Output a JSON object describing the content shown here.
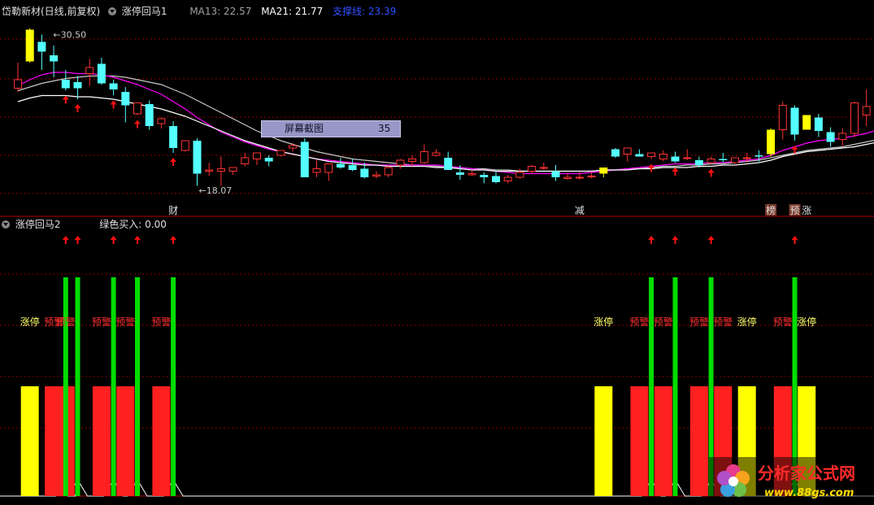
{
  "top_panel": {
    "title": "岱勒新材(日线,前复权)",
    "indicator": "涨停回马1",
    "ma13_label": "MA13: 22.57",
    "ma21_label": "MA21: 21.77",
    "support_label": "支撑线: 23.39",
    "high_label": "30.50",
    "low_label": "18.07",
    "markers": [
      {
        "text": "财",
        "bar": 13
      },
      {
        "text": "减",
        "bar": 47
      },
      {
        "text": "榜",
        "bar": 63
      },
      {
        "text": "预",
        "bar": 65
      },
      {
        "text": "涨",
        "bar": 66
      }
    ]
  },
  "bottom_panel": {
    "indicator": "涨停回马2",
    "green_buy_label": "绿色买入: 0.00"
  },
  "popup": {
    "label": "屏幕截图",
    "value": "35"
  },
  "watermark": {
    "brand": "分析家公式网",
    "url": "www.88gs.com"
  },
  "colors": {
    "bull": "#ff3232",
    "bear": "#54ffff",
    "limit_up": "#ffff00",
    "ma_white": "#ffffff",
    "ma_magenta": "#ff00ff",
    "ma_gray": "#c8c8c8",
    "signal_green": "#00dd00",
    "signal_red": "#ff2020",
    "signal_yellow": "#ffff00",
    "label_yellow": "#ffff66",
    "label_red": "#ff3030",
    "grid": "#8b0000"
  },
  "chart_data": {
    "type": "candlestick",
    "y_high_marked": 30.5,
    "y_low_marked": 18.07,
    "candles": [
      [
        26.1,
        28.2,
        26.8,
        25.8
      ],
      [
        28.3,
        31.0,
        30.9,
        28.2
      ],
      [
        29.9,
        30.5,
        29.1,
        27.6
      ],
      [
        28.8,
        29.6,
        28.3,
        27.0
      ],
      [
        26.8,
        27.6,
        26.1,
        25.9
      ],
      [
        26.6,
        27.1,
        26.1,
        25.2
      ],
      [
        27.3,
        28.5,
        27.8,
        26.3
      ],
      [
        28.1,
        28.6,
        26.5,
        26.4
      ],
      [
        26.5,
        26.8,
        26.0,
        25.5
      ],
      [
        25.8,
        26.2,
        24.7,
        23.3
      ],
      [
        24.0,
        24.5,
        24.9,
        23.9
      ],
      [
        24.8,
        25.1,
        23.0,
        22.7
      ],
      [
        23.2,
        23.7,
        23.6,
        22.8
      ],
      [
        23.0,
        23.4,
        21.2,
        20.8
      ],
      [
        21.0,
        21.6,
        21.8,
        20.9
      ],
      [
        21.8,
        22.0,
        19.1,
        18.1
      ],
      [
        19.3,
        20.0,
        19.4,
        18.9
      ],
      [
        19.3,
        20.5,
        19.5,
        18.1
      ],
      [
        19.3,
        19.6,
        19.6,
        19.0
      ],
      [
        19.9,
        20.8,
        20.4,
        19.7
      ],
      [
        20.3,
        20.7,
        20.8,
        19.8
      ],
      [
        20.4,
        20.6,
        20.1,
        19.7
      ],
      [
        20.6,
        21.0,
        21.0,
        20.5
      ],
      [
        21.2,
        21.6,
        21.4,
        20.9
      ],
      [
        21.7,
        22.0,
        18.8,
        18.8
      ],
      [
        19.2,
        20.2,
        19.5,
        18.8
      ],
      [
        19.2,
        19.5,
        19.9,
        18.5
      ],
      [
        19.9,
        20.4,
        19.6,
        19.5
      ],
      [
        19.8,
        20.3,
        19.4,
        19.3
      ],
      [
        19.5,
        20.0,
        18.8,
        18.7
      ],
      [
        18.9,
        19.3,
        19.0,
        18.7
      ],
      [
        19.0,
        19.8,
        19.6,
        18.8
      ],
      [
        19.8,
        20.3,
        20.2,
        19.5
      ],
      [
        20.1,
        20.6,
        20.3,
        19.7
      ],
      [
        20.0,
        21.5,
        20.9,
        19.9
      ],
      [
        20.6,
        21.1,
        20.8,
        20.5
      ],
      [
        20.4,
        20.9,
        19.4,
        19.4
      ],
      [
        19.2,
        19.8,
        19.0,
        18.6
      ],
      [
        19.0,
        19.4,
        19.1,
        18.9
      ],
      [
        19.0,
        19.2,
        18.8,
        18.3
      ],
      [
        18.9,
        19.3,
        18.4,
        18.3
      ],
      [
        18.5,
        19.0,
        18.8,
        18.3
      ],
      [
        18.8,
        19.5,
        19.2,
        18.7
      ],
      [
        19.3,
        19.8,
        19.7,
        19.1
      ],
      [
        19.6,
        20.0,
        19.6,
        19.4
      ],
      [
        19.3,
        19.8,
        18.8,
        18.5
      ],
      [
        18.7,
        19.1,
        18.8,
        18.6
      ],
      [
        18.8,
        19.2,
        18.8,
        18.6
      ],
      [
        18.9,
        19.2,
        18.9,
        18.7
      ],
      [
        19.1,
        19.4,
        19.6,
        18.8
      ],
      [
        21.1,
        21.2,
        20.5,
        20.4
      ],
      [
        20.7,
        21.1,
        21.2,
        20.1
      ],
      [
        20.7,
        21.1,
        20.5,
        20.5
      ],
      [
        20.5,
        20.8,
        20.8,
        20.3
      ],
      [
        20.3,
        21.0,
        20.7,
        20.1
      ],
      [
        20.5,
        20.9,
        20.1,
        20.0
      ],
      [
        20.4,
        21.1,
        20.4,
        20.2
      ],
      [
        20.2,
        20.5,
        19.8,
        19.6
      ],
      [
        20.0,
        20.5,
        20.3,
        19.9
      ],
      [
        20.3,
        20.8,
        20.2,
        20.0
      ],
      [
        20.0,
        20.4,
        20.4,
        19.9
      ],
      [
        20.4,
        20.8,
        20.4,
        20.0
      ],
      [
        20.6,
        21.0,
        20.5,
        20.1
      ],
      [
        20.7,
        22.8,
        22.7,
        20.5
      ],
      [
        22.7,
        25.0,
        24.7,
        21.9
      ],
      [
        24.5,
        24.7,
        22.3,
        21.8
      ],
      [
        22.7,
        23.2,
        23.9,
        22.7
      ],
      [
        23.7,
        24.0,
        22.6,
        22.1
      ],
      [
        22.5,
        22.9,
        21.7,
        21.3
      ],
      [
        21.9,
        22.8,
        22.4,
        21.4
      ],
      [
        22.4,
        25.0,
        24.9,
        22.1
      ],
      [
        23.9,
        26.0,
        24.6,
        23.0
      ],
      [
        24.9,
        26.3,
        26.0,
        24.4
      ],
      [
        25.3,
        26.1,
        26.2,
        24.5
      ],
      [
        26.2,
        28.2,
        27.5,
        25.7
      ]
    ],
    "ma13": [
      26.3,
      26.8,
      27.2,
      27.4,
      27.4,
      27.3,
      27.3,
      27.2,
      27.0,
      26.7,
      26.4,
      26.0,
      25.6,
      25.0,
      24.4,
      23.7,
      23.1,
      22.5,
      22.1,
      21.7,
      21.4,
      21.1,
      20.9,
      20.7,
      20.5,
      20.3,
      20.2,
      20.1,
      20.0,
      19.9,
      19.8,
      19.8,
      19.8,
      19.8,
      19.8,
      19.8,
      19.7,
      19.6,
      19.5,
      19.4,
      19.3,
      19.2,
      19.1,
      19.1,
      19.1,
      19.1,
      19.1,
      19.1,
      19.2,
      19.3,
      19.4,
      19.5,
      19.6,
      19.7,
      19.8,
      19.9,
      19.9,
      19.9,
      20.0,
      20.0,
      20.1,
      20.2,
      20.3,
      20.6,
      21.0,
      21.3,
      21.6,
      21.8,
      21.9,
      22.0,
      22.2,
      22.4,
      22.7,
      23.1,
      23.5
    ],
    "ma21": [
      25.9,
      26.2,
      26.5,
      26.7,
      26.9,
      27.0,
      27.1,
      27.1,
      27.1,
      27.0,
      26.8,
      26.6,
      26.4,
      26.0,
      25.6,
      25.1,
      24.6,
      24.1,
      23.6,
      23.1,
      22.6,
      22.2,
      21.8,
      21.5,
      21.2,
      20.9,
      20.7,
      20.5,
      20.3,
      20.2,
      20.1,
      20.0,
      19.9,
      19.8,
      19.8,
      19.7,
      19.6,
      19.6,
      19.5,
      19.5,
      19.4,
      19.4,
      19.3,
      19.3,
      19.3,
      19.3,
      19.3,
      19.3,
      19.3,
      19.4,
      19.4,
      19.5,
      19.5,
      19.6,
      19.7,
      19.7,
      19.8,
      19.8,
      19.9,
      19.9,
      20.0,
      20.1,
      20.2,
      20.4,
      20.6,
      20.8,
      21.0,
      21.1,
      21.2,
      21.3,
      21.5,
      21.7,
      21.9,
      22.2,
      22.5
    ],
    "support_line": [
      25.0,
      25.3,
      25.5,
      25.5,
      25.5,
      25.4,
      25.4,
      25.3,
      25.2,
      25.0,
      24.8,
      24.6,
      24.4,
      24.1,
      23.8,
      23.4,
      23.0,
      22.6,
      22.2,
      21.8,
      21.5,
      21.2,
      20.9,
      20.7,
      20.5,
      20.3,
      20.1,
      20.0,
      19.9,
      19.8,
      19.8,
      19.7,
      19.7,
      19.7,
      19.7,
      19.6,
      19.6,
      19.5,
      19.4,
      19.4,
      19.3,
      19.3,
      19.3,
      19.3,
      19.3,
      19.3,
      19.3,
      19.3,
      19.3,
      19.4,
      19.4,
      19.4,
      19.5,
      19.5,
      19.6,
      19.6,
      19.6,
      19.7,
      19.7,
      19.8,
      19.8,
      19.9,
      20.0,
      20.2,
      20.5,
      20.7,
      20.9,
      21.0,
      21.1,
      21.2,
      21.3,
      21.5,
      21.7,
      22.0,
      22.4
    ],
    "up_arrow_bars": [
      4,
      5,
      8,
      10,
      13,
      53,
      55,
      58,
      65
    ],
    "bottom_signals": [
      {
        "bar": 1,
        "bar_color": "yellow",
        "label": "涨停",
        "label_color": "yellow",
        "green_line": false
      },
      {
        "bar": 3,
        "bar_color": "red",
        "label": "预警",
        "label_color": "red",
        "green_line": false
      },
      {
        "bar": 4,
        "bar_color": "red",
        "label": "预警",
        "label_color": "red",
        "green_line": true
      },
      {
        "bar": 5,
        "bar_color": "none",
        "label": "",
        "label_color": "red",
        "green_line": true
      },
      {
        "bar": 7,
        "bar_color": "red",
        "label": "预警",
        "label_color": "red",
        "green_line": false
      },
      {
        "bar": 8,
        "bar_color": "none",
        "label": "",
        "label_color": "red",
        "green_line": true
      },
      {
        "bar": 9,
        "bar_color": "red",
        "label": "预警",
        "label_color": "red",
        "green_line": false
      },
      {
        "bar": 10,
        "bar_color": "none",
        "label": "",
        "label_color": "red",
        "green_line": true
      },
      {
        "bar": 12,
        "bar_color": "red",
        "label": "预警",
        "label_color": "red",
        "green_line": false
      },
      {
        "bar": 13,
        "bar_color": "none",
        "label": "",
        "label_color": "red",
        "green_line": true
      },
      {
        "bar": 49,
        "bar_color": "yellow",
        "label": "涨停",
        "label_color": "yellow",
        "green_line": false
      },
      {
        "bar": 52,
        "bar_color": "red",
        "label": "预警",
        "label_color": "red",
        "green_line": false
      },
      {
        "bar": 53,
        "bar_color": "none",
        "label": "",
        "label_color": "red",
        "green_line": true
      },
      {
        "bar": 54,
        "bar_color": "red",
        "label": "预警",
        "label_color": "red",
        "green_line": false
      },
      {
        "bar": 55,
        "bar_color": "none",
        "label": "",
        "label_color": "red",
        "green_line": true
      },
      {
        "bar": 57,
        "bar_color": "red",
        "label": "预警",
        "label_color": "red",
        "green_line": false
      },
      {
        "bar": 58,
        "bar_color": "none",
        "label": "",
        "label_color": "red",
        "green_line": true
      },
      {
        "bar": 59,
        "bar_color": "red",
        "label": "预警",
        "label_color": "red",
        "green_line": false
      },
      {
        "bar": 61,
        "bar_color": "yellow",
        "label": "涨停",
        "label_color": "yellow",
        "green_line": false
      },
      {
        "bar": 64,
        "bar_color": "red",
        "label": "预警",
        "label_color": "red",
        "green_line": false
      },
      {
        "bar": 65,
        "bar_color": "none",
        "label": "",
        "label_color": "red",
        "green_line": true
      },
      {
        "bar": 66,
        "bar_color": "yellow",
        "label": "涨停",
        "label_color": "yellow",
        "green_line": false
      }
    ]
  }
}
